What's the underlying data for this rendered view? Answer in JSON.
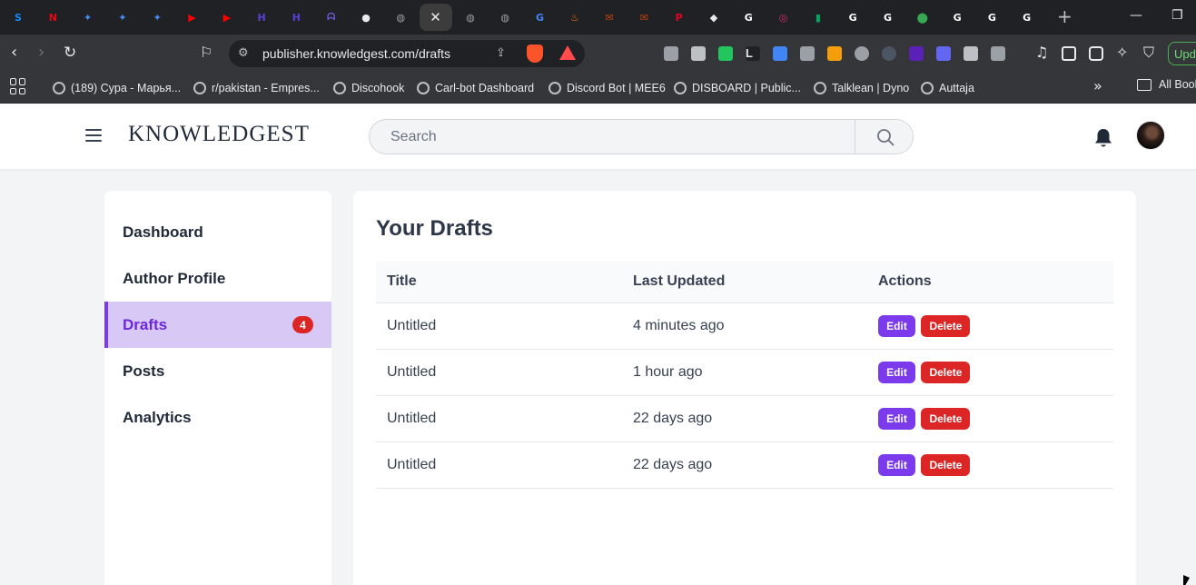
{
  "browser": {
    "tabs": [
      {
        "icon": "stackblitz-icon",
        "color": "#1389fd",
        "glyph": "S"
      },
      {
        "icon": "netflix-icon",
        "color": "#e50914",
        "glyph": "N"
      },
      {
        "icon": "gemini-icon",
        "color": "#4a8cf7",
        "glyph": "✦"
      },
      {
        "icon": "gemini-icon",
        "color": "#4a8cf7",
        "glyph": "✦"
      },
      {
        "icon": "gemini-icon",
        "color": "#4a8cf7",
        "glyph": "✦"
      },
      {
        "icon": "youtube-icon",
        "color": "#ff0000",
        "glyph": "▶"
      },
      {
        "icon": "youtube-icon",
        "color": "#ff0000",
        "glyph": "▶"
      },
      {
        "icon": "hashnode-icon",
        "color": "#5b3fd6",
        "glyph": "H"
      },
      {
        "icon": "hashnode-icon",
        "color": "#5b3fd6",
        "glyph": "H"
      },
      {
        "icon": "ghost-icon",
        "color": "#6b5bd6",
        "glyph": "ᗣ"
      },
      {
        "icon": "github-icon",
        "color": "#e8eaed",
        "glyph": "●"
      },
      {
        "icon": "globe-icon",
        "color": "#9aa0a6",
        "glyph": "◍"
      },
      {
        "icon": "close-icon",
        "color": "#e8eaed",
        "glyph": "✕"
      },
      {
        "icon": "globe-icon",
        "color": "#9aa0a6",
        "glyph": "◍"
      },
      {
        "icon": "globe-icon",
        "color": "#9aa0a6",
        "glyph": "◍"
      },
      {
        "icon": "translate-icon",
        "color": "#4285f4",
        "glyph": "G"
      },
      {
        "icon": "fire-icon",
        "color": "#f97316",
        "glyph": "♨"
      },
      {
        "icon": "mail-icon",
        "color": "#c2410c",
        "glyph": "✉"
      },
      {
        "icon": "mail-icon",
        "color": "#c2410c",
        "glyph": "✉"
      },
      {
        "icon": "pinterest-icon",
        "color": "#e60023",
        "glyph": "P"
      },
      {
        "icon": "package-icon",
        "color": "#e8eaed",
        "glyph": "◆"
      },
      {
        "icon": "google-icon",
        "color": "#ffffff",
        "glyph": "G"
      },
      {
        "icon": "instagram-icon",
        "color": "#d62976",
        "glyph": "◎"
      },
      {
        "icon": "meet-icon",
        "color": "#00a862",
        "glyph": "▮"
      },
      {
        "icon": "google-icon",
        "color": "#ffffff",
        "glyph": "G"
      },
      {
        "icon": "google-icon",
        "color": "#ffffff",
        "glyph": "G"
      },
      {
        "icon": "maps-icon",
        "color": "#34a853",
        "glyph": "⬤"
      },
      {
        "icon": "google-icon",
        "color": "#ffffff",
        "glyph": "G"
      },
      {
        "icon": "google-icon",
        "color": "#ffffff",
        "glyph": "G"
      },
      {
        "icon": "google-icon",
        "color": "#ffffff",
        "glyph": "G"
      }
    ],
    "url": "publisher.knowledgest.com/drafts",
    "update_label": "Upd",
    "bookmarks": [
      {
        "label": "(189) Cypa - Марья..."
      },
      {
        "label": "r/pakistan - Empres..."
      },
      {
        "label": "Discohook"
      },
      {
        "label": "Carl-bot Dashboard"
      },
      {
        "label": "Discord Bot | MEE6"
      },
      {
        "label": "DISBOARD | Public..."
      },
      {
        "label": "Talklean | Dyno"
      },
      {
        "label": "Auttaja"
      }
    ],
    "all_bookmarks_label": "All Book"
  },
  "header": {
    "logo": "KNOWLEDGEST",
    "search_placeholder": "Search"
  },
  "sidebar": {
    "items": [
      {
        "label": "Dashboard"
      },
      {
        "label": "Author Profile"
      },
      {
        "label": "Drafts",
        "badge": "4"
      },
      {
        "label": "Posts"
      },
      {
        "label": "Analytics"
      }
    ]
  },
  "main": {
    "title": "Your Drafts",
    "columns": [
      "Title",
      "Last Updated",
      "Actions"
    ],
    "rows": [
      {
        "title": "Untitled",
        "updated": "4 minutes ago",
        "edit": "Edit",
        "delete": "Delete"
      },
      {
        "title": "Untitled",
        "updated": "1 hour ago",
        "edit": "Edit",
        "delete": "Delete"
      },
      {
        "title": "Untitled",
        "updated": "22 days ago",
        "edit": "Edit",
        "delete": "Delete"
      },
      {
        "title": "Untitled",
        "updated": "22 days ago",
        "edit": "Edit",
        "delete": "Delete"
      }
    ]
  },
  "colors": {
    "accent": "#7c3aed",
    "danger": "#dc2626",
    "active_bg": "#d8c8f5"
  }
}
